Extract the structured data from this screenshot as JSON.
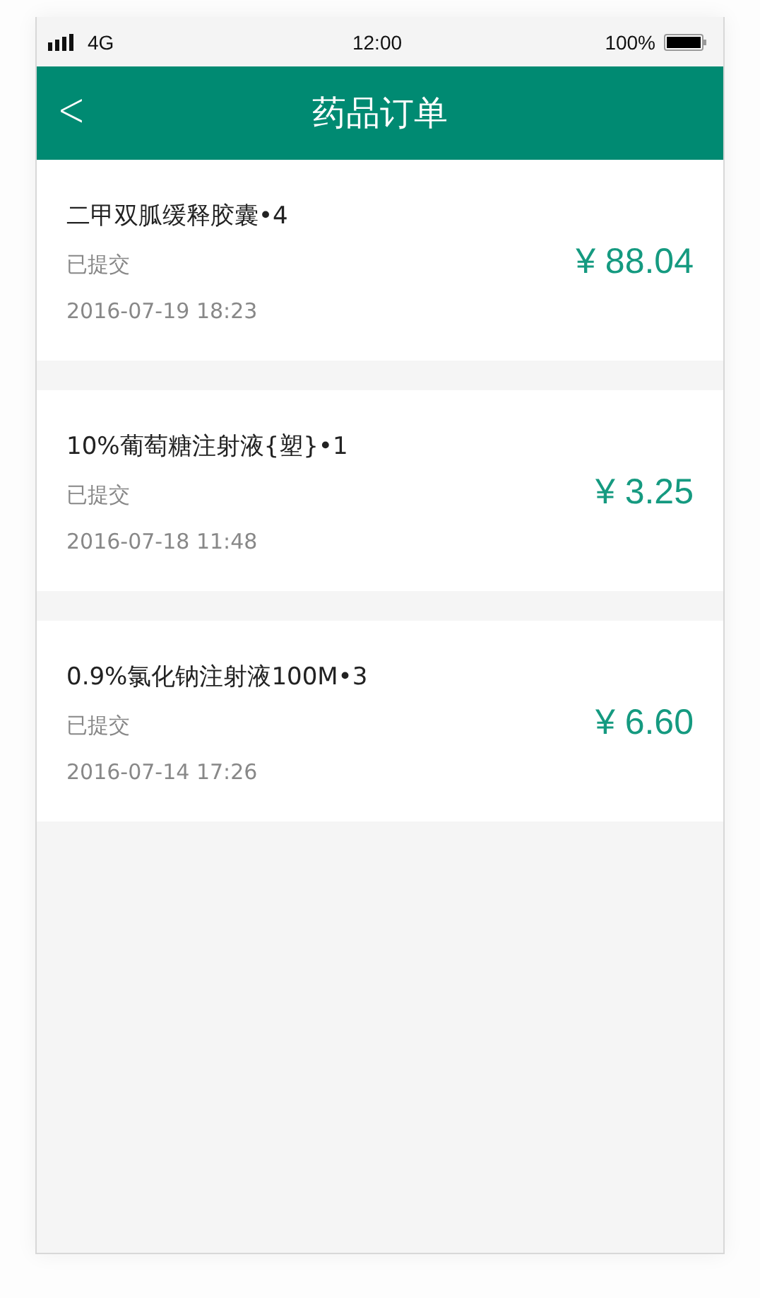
{
  "status_bar": {
    "network": "4G",
    "time": "12:00",
    "battery": "100%"
  },
  "header": {
    "back": "<",
    "title": "药品订单"
  },
  "orders": [
    {
      "name": "二甲双胍缓释胶囊•4",
      "status": "已提交",
      "date": "2016-07-19 18:23",
      "price": "¥ 88.04"
    },
    {
      "name": "10%葡萄糖注射液{塑}•1",
      "status": "已提交",
      "date": "2016-07-18 11:48",
      "price": "¥ 3.25"
    },
    {
      "name": "0.9%氯化钠注射液100M•3",
      "status": "已提交",
      "date": "2016-07-14 17:26",
      "price": "¥ 6.60"
    }
  ]
}
